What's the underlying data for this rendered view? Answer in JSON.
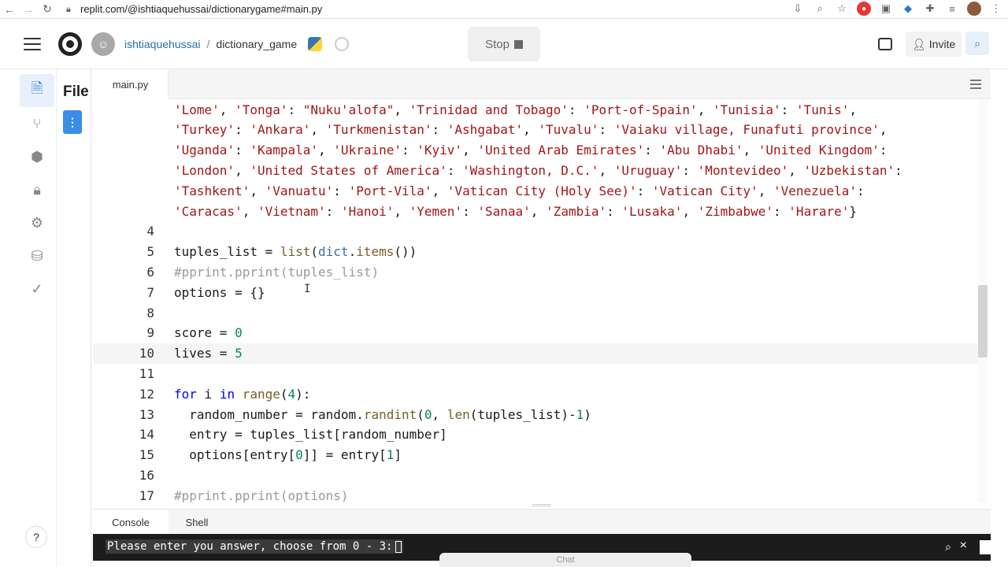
{
  "browser": {
    "url": "replit.com/@ishtiaquehussai/dictionarygame#main.py"
  },
  "header": {
    "username": "ishtiaquehussai",
    "separator": "/",
    "repl_name": "dictionary_game",
    "stop_label": "Stop",
    "invite_label": "Invite"
  },
  "files_panel": {
    "title": "File"
  },
  "editor": {
    "tab_label": "main.py"
  },
  "code_lines": [
    {
      "ln": "",
      "html": "<span class=\"str\">'Lome'</span>, <span class=\"str\">'Tonga'</span>: <span class=\"str\">\"Nuku'alofa\"</span>, <span class=\"str\">'Trinidad and Tobago'</span>: <span class=\"str\">'Port-of-Spain'</span>, <span class=\"str\">'Tunisia'</span>: <span class=\"str\">'Tunis'</span>,"
    },
    {
      "ln": "",
      "html": "<span class=\"str\">'Turkey'</span>: <span class=\"str\">'Ankara'</span>, <span class=\"str\">'Turkmenistan'</span>: <span class=\"str\">'Ashgabat'</span>, <span class=\"str\">'Tuvalu'</span>: <span class=\"str\">'Vaiaku village, Funafuti province'</span>,"
    },
    {
      "ln": "",
      "html": "<span class=\"str\">'Uganda'</span>: <span class=\"str\">'Kampala'</span>, <span class=\"str\">'Ukraine'</span>: <span class=\"str\">'Kyiv'</span>, <span class=\"str\">'United Arab Emirates'</span>: <span class=\"str\">'Abu Dhabi'</span>, <span class=\"str\">'United Kingdom'</span>:"
    },
    {
      "ln": "",
      "html": "<span class=\"str\">'London'</span>, <span class=\"str\">'United States of America'</span>: <span class=\"str\">'Washington, D.C.'</span>, <span class=\"str\">'Uruguay'</span>: <span class=\"str\">'Montevideo'</span>, <span class=\"str\">'Uzbekistan'</span>:"
    },
    {
      "ln": "",
      "html": "<span class=\"str\">'Tashkent'</span>, <span class=\"str\">'Vanuatu'</span>: <span class=\"str\">'Port-Vila'</span>, <span class=\"str\">'Vatican City (Holy See)'</span>: <span class=\"str\">'Vatican City'</span>, <span class=\"str\">'Venezuela'</span>:"
    },
    {
      "ln": "",
      "html": "<span class=\"str\">'Caracas'</span>, <span class=\"str\">'Vietnam'</span>: <span class=\"str\">'Hanoi'</span>, <span class=\"str\">'Yemen'</span>: <span class=\"str\">'Sanaa'</span>, <span class=\"str\">'Zambia'</span>: <span class=\"str\">'Lusaka'</span>, <span class=\"str\">'Zimbabwe'</span>: <span class=\"str\">'Harare'</span>}"
    },
    {
      "ln": "4",
      "html": ""
    },
    {
      "ln": "5",
      "html": "tuples_list = <span class=\"bi\">list</span>(<span class=\"fn\">dict</span>.<span class=\"bi\">items</span>())"
    },
    {
      "ln": "6",
      "html": "<span class=\"cm\">#pprint.pprint(tuples_list)</span>"
    },
    {
      "ln": "7",
      "html": "options = {}"
    },
    {
      "ln": "8",
      "html": ""
    },
    {
      "ln": "9",
      "html": "score = <span class=\"num\">0</span>"
    },
    {
      "ln": "10",
      "html": "lives = <span class=\"num\">5</span>",
      "active": true
    },
    {
      "ln": "11",
      "html": ""
    },
    {
      "ln": "12",
      "html": "<span class=\"kw\">for</span> i <span class=\"kw\">in</span> <span class=\"bi\">range</span>(<span class=\"num\">4</span>):"
    },
    {
      "ln": "13",
      "html": "  random_number = random.<span class=\"bi\">randint</span>(<span class=\"num\">0</span>, <span class=\"bi\">len</span>(tuples_list)-<span class=\"num\">1</span>)"
    },
    {
      "ln": "14",
      "html": "  entry = tuples_list[random_number]"
    },
    {
      "ln": "15",
      "html": "  options[entry[<span class=\"num\">0</span>]] = entry[<span class=\"num\">1</span>]"
    },
    {
      "ln": "16",
      "html": ""
    },
    {
      "ln": "17",
      "html": "<span class=\"cm\">#pprint.pprint(options)</span>"
    }
  ],
  "console_tabs": [
    "Console",
    "Shell"
  ],
  "console": {
    "prompt": "Please enter you answer, choose from 0 - 3:"
  },
  "chat_widget": {
    "label": "Chat"
  },
  "colors": {
    "accent": "#3a8ee6",
    "string": "#a31515",
    "keyword": "#0000ff",
    "number": "#098658",
    "comment": "#9a9a9a"
  }
}
